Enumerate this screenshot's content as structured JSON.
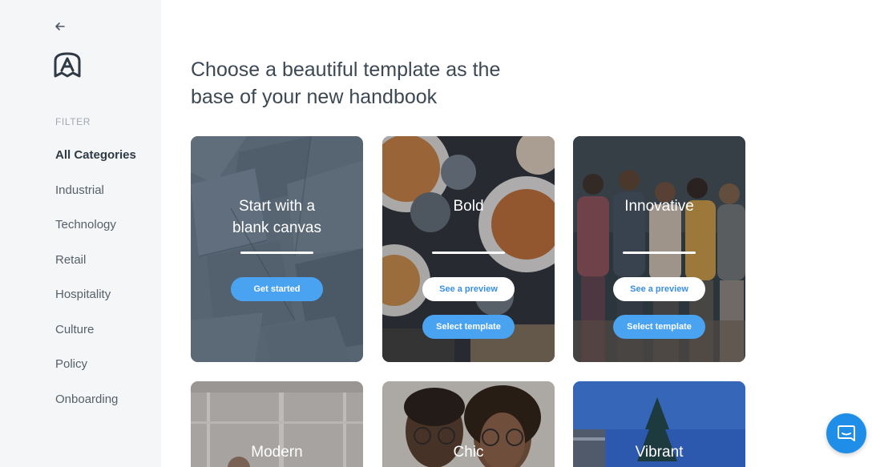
{
  "sidebar": {
    "filter_heading": "FILTER",
    "categories": [
      {
        "label": "All Categories",
        "active": true
      },
      {
        "label": "Industrial"
      },
      {
        "label": "Technology"
      },
      {
        "label": "Retail"
      },
      {
        "label": "Hospitality"
      },
      {
        "label": "Culture"
      },
      {
        "label": "Policy"
      },
      {
        "label": "Onboarding"
      }
    ]
  },
  "main": {
    "heading": "Choose a beautiful template as the base of your new handbook",
    "cards": [
      {
        "title_line1": "Start with a",
        "title_line2": "blank canvas",
        "button": "Get started"
      },
      {
        "title": "Bold",
        "preview_button": "See a preview",
        "select_button": "Select template"
      },
      {
        "title": "Innovative",
        "preview_button": "See a preview",
        "select_button": "Select template"
      },
      {
        "title": "Modern"
      },
      {
        "title": "Chic"
      },
      {
        "title": "Vibrant"
      }
    ]
  },
  "icons": {
    "back": "back-arrow-icon",
    "logo": "handbook-logo-icon",
    "chat": "chat-bubble-icon"
  },
  "colors": {
    "accent": "#4aa3f1",
    "chat": "#1f8ee8",
    "sidebar_bg": "#f5f6f7"
  }
}
